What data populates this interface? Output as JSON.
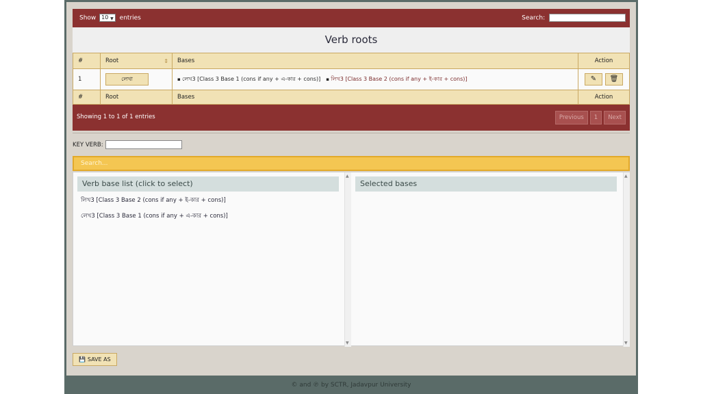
{
  "table_controls": {
    "show_label": "Show",
    "entries_value": "10",
    "entries_label": "entries",
    "search_label": "Search:"
  },
  "page_title": "Verb roots",
  "table": {
    "headers": [
      "#",
      "Root",
      "Bases",
      "Action"
    ],
    "rows": [
      {
        "index": "1",
        "root": "লেখা",
        "bases": [
          "লেখ3 [Class 3 Base 1 (cons if any + এ-কার + cons)]",
          "লিখ3 [Class 3 Base 2 (cons if any + ই-কার + cons)]"
        ]
      }
    ],
    "footer_headers": [
      "#",
      "Root",
      "Bases",
      "Action"
    ]
  },
  "pagination": {
    "showing_text": "Showing 1 to 1 of 1 entries",
    "previous_label": "Previous",
    "page_number": "1",
    "next_label": "Next"
  },
  "key_verb": {
    "label": "KEY VERB:",
    "value": ""
  },
  "base_search": {
    "placeholder": "Search..."
  },
  "verb_base_list": {
    "title": "Verb base list (click to select)",
    "items": [
      "লিখ3 [Class 3 Base 2 (cons if any + ই-কার + cons)]",
      "লেখ3 [Class 3 Base 1 (cons if any + এ-কার + cons)]"
    ]
  },
  "selected_bases": {
    "title": "Selected bases",
    "items": []
  },
  "save_label": "SAVE AS",
  "footer_text": "© and ℗ by SCTR, Jadavpur University",
  "colors": {
    "header_red": "#8b3130",
    "table_beige": "#f1e2b5",
    "search_yellow": "#f4c652",
    "frame_slate": "#5a6b68"
  }
}
